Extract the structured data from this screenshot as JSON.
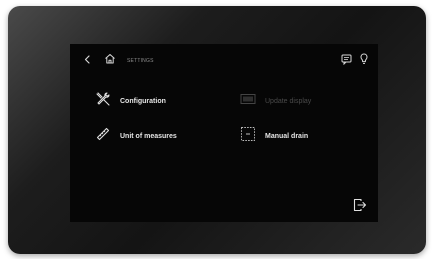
{
  "header": {
    "breadcrumb": "SETTINGS"
  },
  "menu": {
    "configuration_label": "Configuration",
    "units_label": "Unit of measures",
    "update_label": "Update display",
    "manual_drain_label": "Manual drain"
  },
  "colors": {
    "screen_background": "#060606",
    "text_active": "#e6e6e6",
    "text_disabled": "#4a4a4a",
    "icon": "#d8d8d8"
  },
  "icons": {
    "back": "chevron-left-icon",
    "home": "home-icon",
    "chat": "message-icon",
    "light": "lightbulb-icon",
    "configuration": "tools-icon",
    "units": "ruler-icon",
    "update": "display-update-icon",
    "manual_drain": "drain-icon",
    "exit": "exit-icon"
  }
}
